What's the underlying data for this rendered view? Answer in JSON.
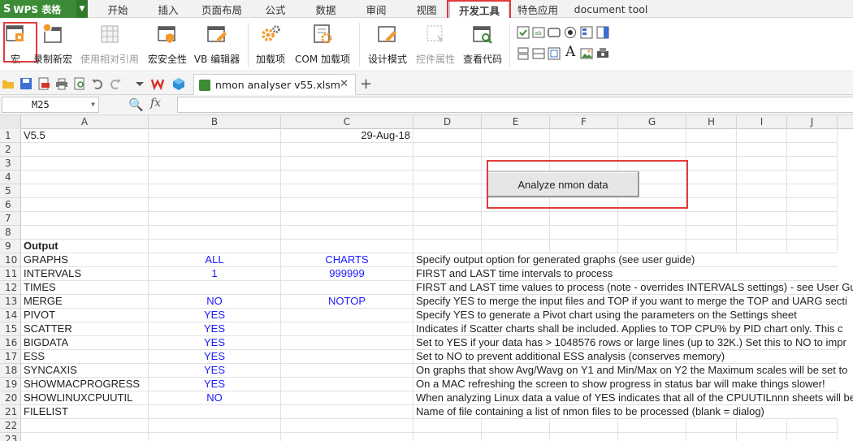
{
  "app": {
    "logo_text": "WPS 表格",
    "logo_glyph": "S",
    "logo_dropdown": "▼"
  },
  "menu": {
    "tabs": [
      "开始",
      "插入",
      "页面布局",
      "公式",
      "数据",
      "审阅",
      "视图",
      "开发工具",
      "特色应用",
      "document tool"
    ],
    "active_tab": "开发工具"
  },
  "ribbon": {
    "macro": "宏",
    "record_macro": "录制新宏",
    "relative_ref": "使用相对引用",
    "macro_security": "宏安全性",
    "vb_editor": "VB 编辑器",
    "addins": "加载项",
    "com_addins": "COM 加载项",
    "design_mode": "设计模式",
    "control_props": "控件属性",
    "view_code": "查看代码",
    "text_glyph": "A"
  },
  "doc_tab": {
    "name": "nmon analyser v55.xlsm",
    "close_glyph": "✕",
    "add_glyph": "+"
  },
  "formula_bar": {
    "cell_ref": "M25",
    "fx": "fx",
    "zoom_glyph": "🔍",
    "dropdown_glyph": "▼"
  },
  "grid": {
    "columns": [
      "A",
      "B",
      "C",
      "D",
      "E",
      "F",
      "G",
      "H",
      "I",
      "J"
    ],
    "row_numbers": [
      "1",
      "2",
      "3",
      "4",
      "5",
      "6",
      "7",
      "8",
      "9",
      "10",
      "11",
      "12",
      "13",
      "14",
      "15",
      "16",
      "17",
      "18",
      "19",
      "20",
      "21",
      "22",
      "23"
    ],
    "cells": {
      "A1": "V5.5",
      "C1": "29-Aug-18",
      "A9": "Output",
      "A10": "GRAPHS",
      "B10": "ALL",
      "C10": "CHARTS",
      "D10": "Specify output option for generated graphs (see user guide)",
      "A11": "INTERVALS",
      "B11": "1",
      "C11": "999999",
      "D11": "FIRST and LAST time intervals to process",
      "A12": "TIMES",
      "D12": "FIRST and LAST time values to process (note - overrides INTERVALS settings) - see User Gu",
      "A13": "MERGE",
      "B13": "NO",
      "C13": "NOTOP",
      "D13": "Specify YES to merge the input files and TOP if you want to merge the TOP and UARG secti",
      "A14": "PIVOT",
      "B14": "YES",
      "D14": "Specify YES to generate a Pivot chart using the parameters on the Settings sheet",
      "A15": "SCATTER",
      "B15": "YES",
      "D15": "Indicates if Scatter charts shall be included.  Applies to TOP CPU% by PID chart only.  This c",
      "A16": "BIGDATA",
      "B16": "YES",
      "D16": "Set to YES if your data has > 1048576 rows or large lines (up to 32K.)  Set this to NO to impr",
      "A17": "ESS",
      "B17": "YES",
      "D17": "Set to NO to prevent additional ESS analysis (conserves memory)",
      "A18": "SYNCAXIS",
      "B18": "YES",
      "D18": "On graphs that show Avg/Wavg on Y1 and Min/Max on Y2 the Maximum scales will be set to",
      "A19": "SHOWMACPROGRESS",
      "B19": "YES",
      "D19": "On a MAC refreshing the screen to show progress in status bar will make things slower!",
      "A20": "SHOWLINUXCPUUTIL",
      "B20": "NO",
      "D20": "When analyzing Linux data a value of YES indicates that all of the CPUUTILnnn sheets will be",
      "A21": "FILELIST",
      "D21": "Name of file containing a list of nmon files to be processed (blank = dialog)"
    },
    "analyze_button": "Analyze nmon data"
  },
  "colors": {
    "brand_green": "#3d8b37",
    "highlight_red": "#e23b3b",
    "value_blue": "#1a1aff"
  }
}
